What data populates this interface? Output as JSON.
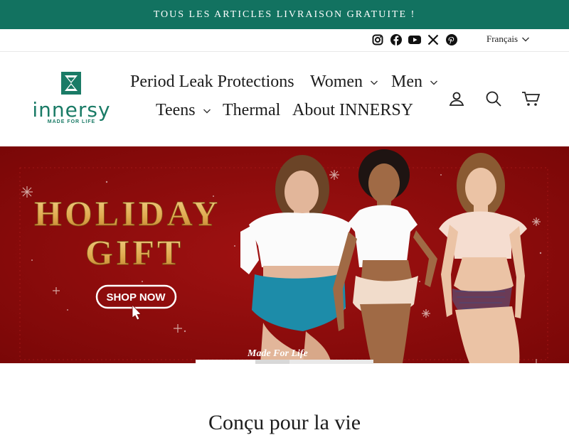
{
  "announcement": "TOUS LES ARTICLES LIVRAISON GRATUITE !",
  "social": [
    "instagram-icon",
    "facebook-icon",
    "youtube-icon",
    "x-icon",
    "pinterest-icon"
  ],
  "language": {
    "selected": "Français"
  },
  "logo": {
    "word": "innersy",
    "tagline": "MADE FOR LIFE"
  },
  "nav": [
    {
      "label": "Period Leak Protections",
      "dropdown": false
    },
    {
      "label": "Women",
      "dropdown": true
    },
    {
      "label": "Men",
      "dropdown": true
    },
    {
      "label": "Teens",
      "dropdown": true
    },
    {
      "label": "Thermal",
      "dropdown": false
    },
    {
      "label": "About INNERSY",
      "dropdown": false
    }
  ],
  "header_icons": [
    "account-icon",
    "search-icon",
    "cart-icon"
  ],
  "hero": {
    "headline_1": "HOLIDAY",
    "headline_2": "GIFT",
    "cta": "SHOP NOW",
    "tagline": "Made For Life",
    "background": "#8f0a0b",
    "slides_total": 3,
    "active_slide": 1
  },
  "section": {
    "title": "Conçu pour la vie"
  },
  "colors": {
    "brand": "#127260",
    "logo": "#1a7b66",
    "hero": "#8f0a0b",
    "gold": "#e5b35c"
  }
}
